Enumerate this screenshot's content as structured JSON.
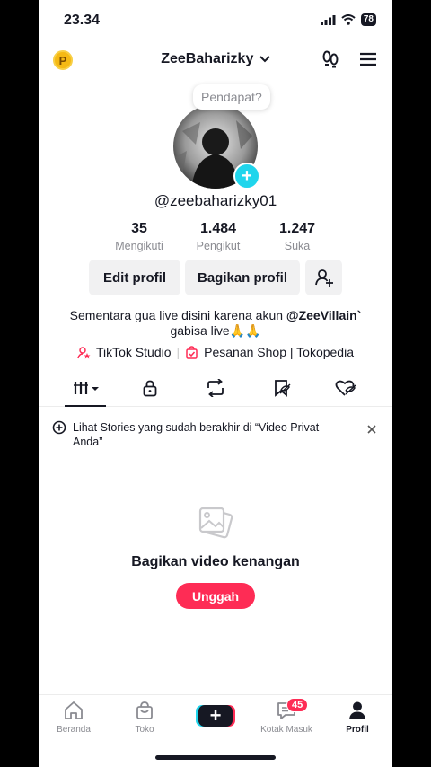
{
  "status": {
    "time": "23.34",
    "battery": "78"
  },
  "header": {
    "username": "ZeeBaharizky",
    "coin_label": "P"
  },
  "profile": {
    "tooltip": "Pendapat?",
    "handle": "@zeebaharizky01",
    "stats": [
      {
        "value": "35",
        "label": "Mengikuti"
      },
      {
        "value": "1.484",
        "label": "Pengikut"
      },
      {
        "value": "1.247",
        "label": "Suka"
      }
    ],
    "edit_label": "Edit profil",
    "share_label": "Bagikan profil",
    "bio_line1": "Sementara gua live disini karena akun ",
    "bio_mention": "@ZeeVillain`",
    "bio_line2": "gabisa live🙏🙏",
    "link_studio": "TikTok Studio",
    "link_shop": "Pesanan Shop | Tokopedia"
  },
  "banner": {
    "text": "Lihat Stories yang sudah berakhir di “Video Privat Anda”"
  },
  "empty": {
    "title": "Bagikan video kenangan",
    "button": "Unggah"
  },
  "nav": {
    "items": [
      {
        "label": "Beranda",
        "icon": "home-icon"
      },
      {
        "label": "Toko",
        "icon": "shop-bag-icon"
      },
      {
        "label": "",
        "icon": "create-plus-icon"
      },
      {
        "label": "Kotak Masuk",
        "icon": "inbox-icon"
      },
      {
        "label": "Profil",
        "icon": "profile-icon"
      }
    ],
    "inbox_badge": "45"
  },
  "colors": {
    "accent": "#fe2c55",
    "cyan": "#20d5ec",
    "coin": "#f5b914"
  }
}
